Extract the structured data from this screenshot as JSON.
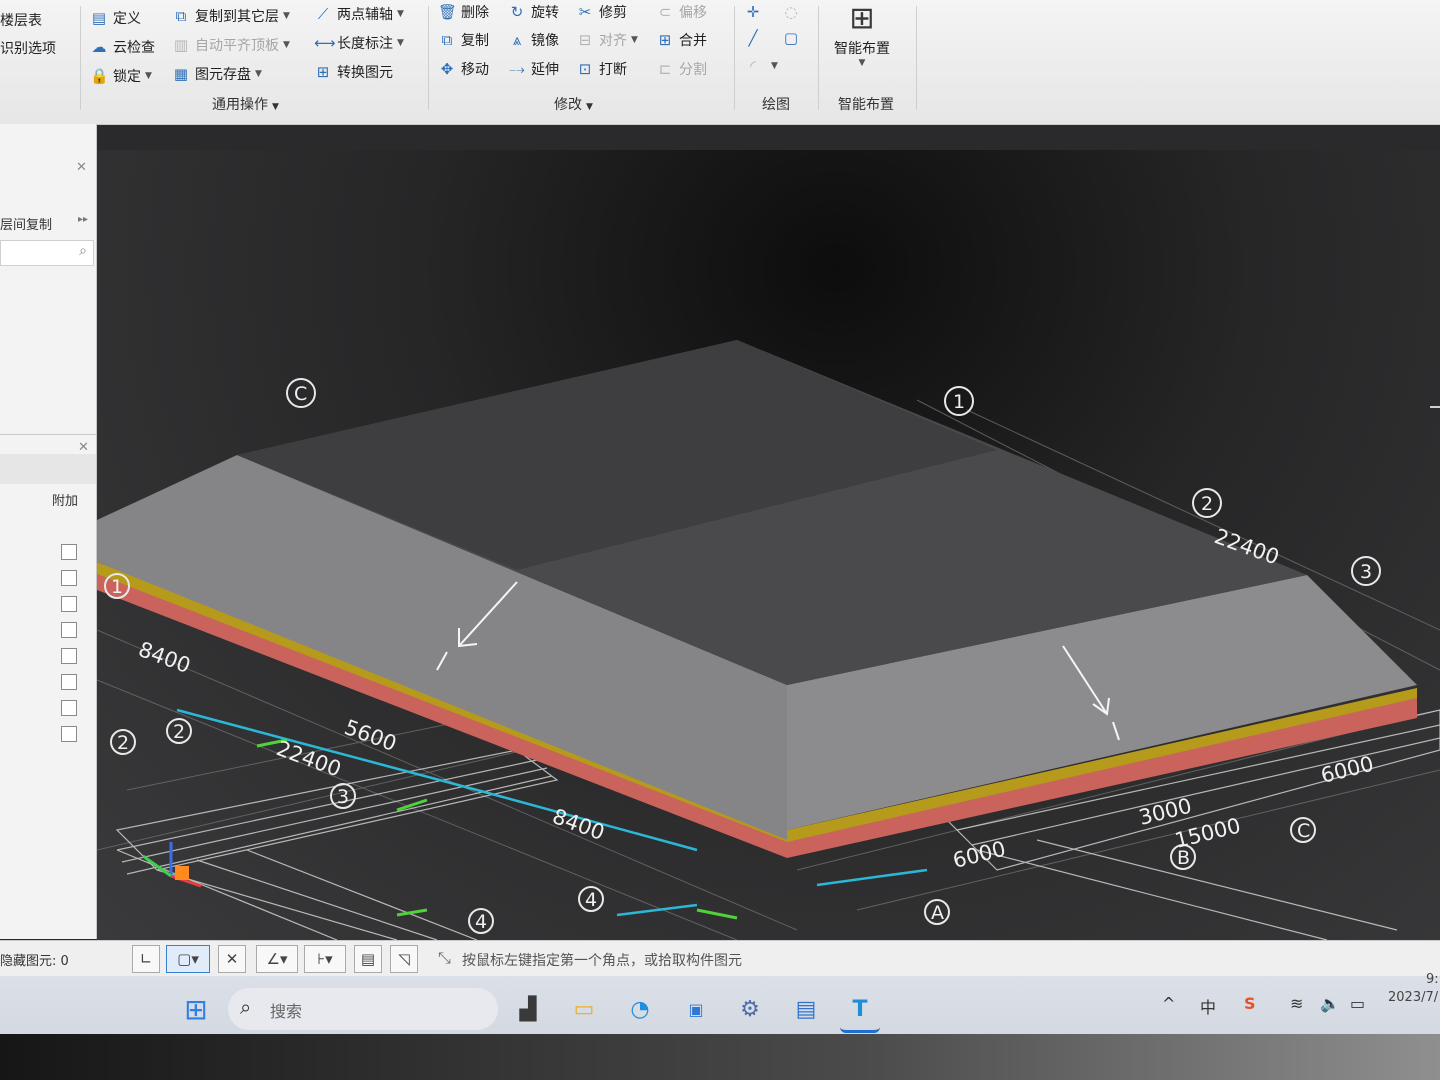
{
  "ribbon": {
    "col0": {
      "r1": "楼层表",
      "r2": "识别选项"
    },
    "col1": {
      "r1": "定义",
      "r2": "云检查",
      "r3": "锁定"
    },
    "col2": {
      "r1": "复制到其它层",
      "r2": "自动平齐顶板",
      "r3": "图元存盘"
    },
    "col3": {
      "r1": "两点辅轴",
      "r2": "长度标注",
      "r3": "转换图元"
    },
    "group_general": "通用操作",
    "modify": {
      "c1": [
        "删除",
        "复制",
        "移动"
      ],
      "c2": [
        "旋转",
        "镜像",
        "延伸"
      ],
      "c3": [
        "修剪",
        "对齐",
        "打断"
      ],
      "c4": [
        "偏移",
        "合并",
        "分割"
      ]
    },
    "group_modify": "修改",
    "group_draw": "绘图",
    "smart_button": "智能布置",
    "group_smart": "智能布置"
  },
  "left_panel": {
    "tab_label": "层间复制",
    "column_header": "附加",
    "checkbox_count": 8
  },
  "viewport": {
    "axis_bubbles": [
      "C",
      "1",
      "2",
      "3",
      "1",
      "2",
      "2",
      "3",
      "4",
      "4",
      "A",
      "B",
      "C"
    ],
    "dimensions": [
      "22400",
      "8400",
      "5600",
      "22400",
      "8400",
      "6000",
      "3000",
      "15000",
      "6000"
    ]
  },
  "status_bar": {
    "hidden_count_text": "隐藏图元: 0",
    "prompt": "按鼠标左键指定第一个角点，或拾取构件图元"
  },
  "taskbar": {
    "search_placeholder": "搜索",
    "ime": "中",
    "date": "2023/7/",
    "time": "9:"
  }
}
